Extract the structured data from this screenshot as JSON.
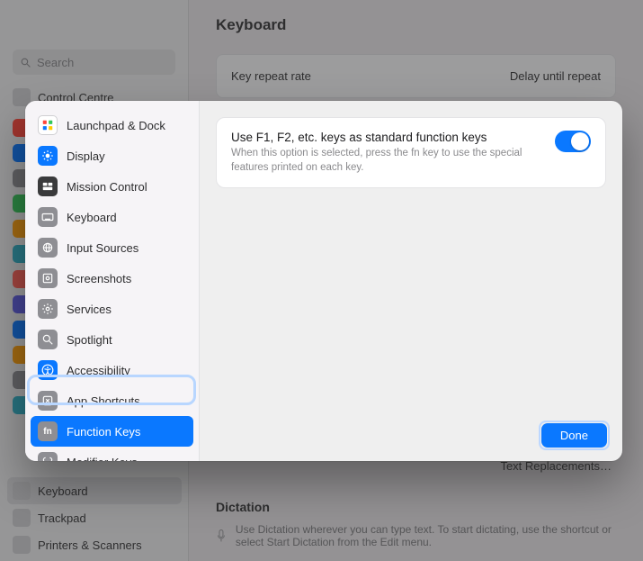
{
  "bg": {
    "search_placeholder": "Search",
    "title": "Keyboard",
    "row": {
      "left": "Key repeat rate",
      "right": "Delay until repeat"
    },
    "sidebar_top": "Control Centre",
    "lower_items": [
      "Keyboard",
      "Trackpad",
      "Printers & Scanners"
    ],
    "text_replacements": "Text Replacements…",
    "dictation": {
      "heading": "Dictation",
      "body": "Use Dictation wherever you can type text. To start dictating, use the shortcut or select Start Dictation from the Edit menu."
    },
    "app_colors": [
      "#ff453a",
      "#0a78ff",
      "#8e8e93",
      "#34c759",
      "#ff9f0a",
      "#30b0c7",
      "#ff5f57",
      "#5e5ce6",
      "#0a78ff",
      "#ff9f0a",
      "#8e8e93",
      "#30b0c7"
    ]
  },
  "sheet": {
    "items": [
      {
        "label": "Launchpad & Dock",
        "icon_bg": "#ffffff",
        "icon_name": "grid-icon"
      },
      {
        "label": "Display",
        "icon_bg": "#0a78ff",
        "icon_name": "sun-icon"
      },
      {
        "label": "Mission Control",
        "icon_bg": "#3a3a3c",
        "icon_name": "mission-icon"
      },
      {
        "label": "Keyboard",
        "icon_bg": "#8e8e93",
        "icon_name": "keyboard-icon"
      },
      {
        "label": "Input Sources",
        "icon_bg": "#8e8e93",
        "icon_name": "globe-icon"
      },
      {
        "label": "Screenshots",
        "icon_bg": "#8e8e93",
        "icon_name": "screenshot-icon"
      },
      {
        "label": "Services",
        "icon_bg": "#8e8e93",
        "icon_name": "gear-icon"
      },
      {
        "label": "Spotlight",
        "icon_bg": "#8e8e93",
        "icon_name": "search-icon"
      },
      {
        "label": "Accessibility",
        "icon_bg": "#0a78ff",
        "icon_name": "accessibility-icon"
      },
      {
        "label": "App Shortcuts",
        "icon_bg": "#8e8e93",
        "icon_name": "shortcut-icon"
      },
      {
        "label": "Function Keys",
        "icon_bg": "#8e8e93",
        "icon_name": "fn-icon",
        "selected": true,
        "fn_text": "fn"
      },
      {
        "label": "Modifier Keys",
        "icon_bg": "#8e8e93",
        "icon_name": "modifier-icon"
      }
    ],
    "setting": {
      "title": "Use F1, F2, etc. keys as standard function keys",
      "desc": "When this option is selected, press the fn key to use the special features printed on each key.",
      "toggle_on": true
    },
    "done_label": "Done"
  }
}
